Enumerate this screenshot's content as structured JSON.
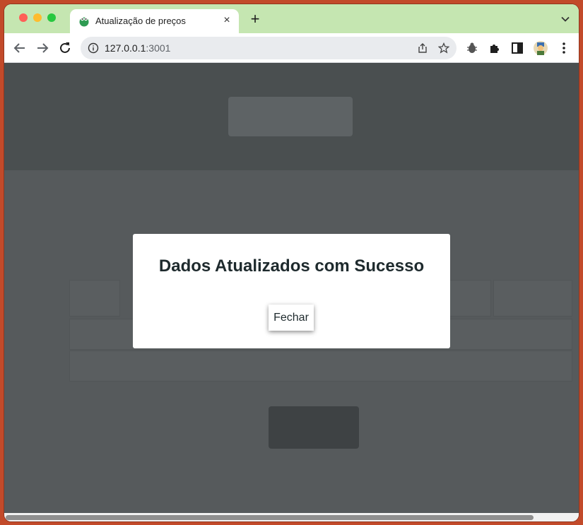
{
  "browser": {
    "tab": {
      "title": "Atualização de preços",
      "close_label": "×",
      "favicon": "green-frog-favicon-icon"
    },
    "new_tab_label": "+",
    "address": {
      "host": "127.0.0.1",
      "port": ":3001"
    },
    "colors": {
      "tabstrip": "#c5e6b1",
      "omnibox": "#e9ebee"
    }
  },
  "page": {
    "overlay_color": "#565a5c"
  },
  "modal": {
    "title": "Dados Atualizados com Sucesso",
    "close_label": "Fechar"
  }
}
